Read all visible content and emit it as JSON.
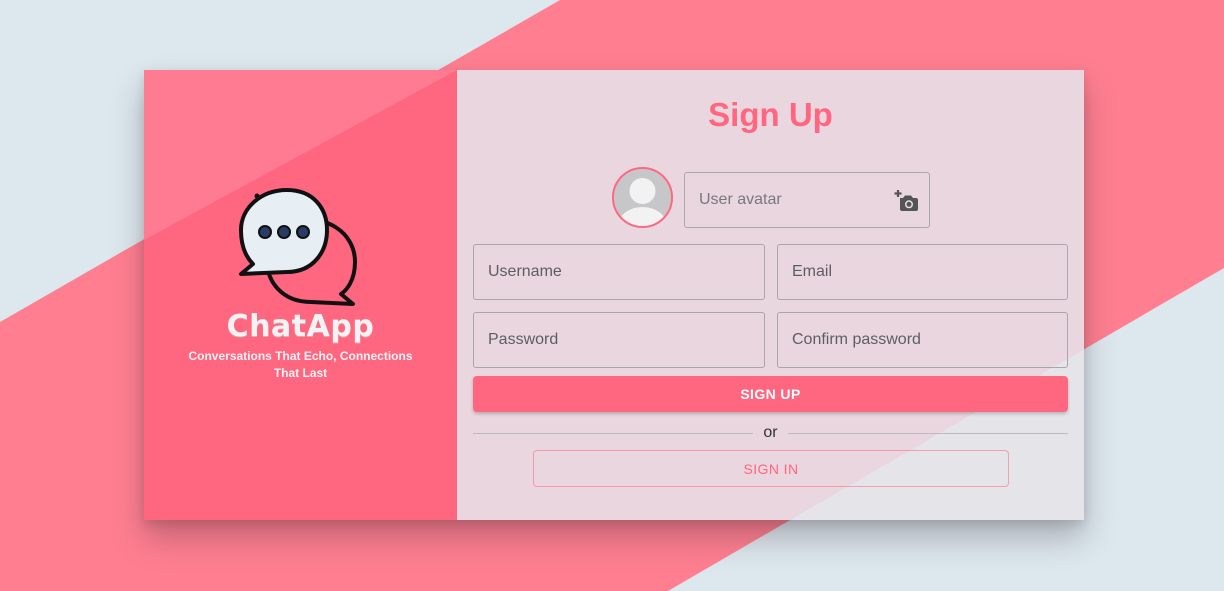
{
  "colors": {
    "accent": "#ff6680",
    "background": "#dce8ee",
    "stripe": "#ff7f91",
    "panel": "#e6e2e8"
  },
  "brand": {
    "logo_icon": "chat-bubbles-icon",
    "name": "ChatApp",
    "tagline": "Conversations That Echo, Connections That Last"
  },
  "form": {
    "title": "Sign Up",
    "avatar_placeholder": "User avatar",
    "avatar_icon": "user-placeholder-icon",
    "camera_icon": "add-photo-camera-icon",
    "username_placeholder": "Username",
    "email_placeholder": "Email",
    "password_placeholder": "Password",
    "confirm_password_placeholder": "Confirm password",
    "signup_label": "SIGN UP",
    "divider_text": "or",
    "signin_label": "SIGN IN"
  }
}
